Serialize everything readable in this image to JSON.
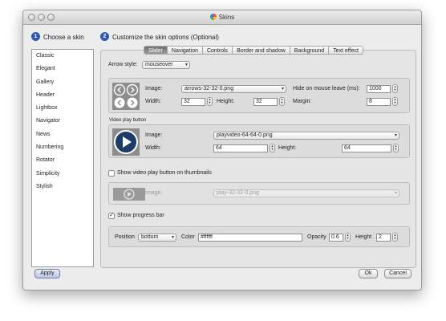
{
  "window": {
    "title": "Skins"
  },
  "step1": {
    "number": "1",
    "title": "Choose a skin"
  },
  "step2": {
    "number": "2",
    "title": "Customize the skin options (Optional)"
  },
  "skins": [
    "Classic",
    "Elegant",
    "Gallery",
    "Header",
    "Lightbox",
    "Navigator",
    "News",
    "Numbering",
    "Rotator",
    "Simplicity",
    "Stylish"
  ],
  "tabs": [
    "Slider",
    "Navigation",
    "Controls",
    "Border and shadow",
    "Background",
    "Text effect"
  ],
  "arrow_style": {
    "label": "Arrow style:",
    "value": "mouseover"
  },
  "arrows": {
    "image_label": "Image:",
    "image_value": "arrows-32-32-0.png",
    "hide_label": "Hide on mouse leave (ms):",
    "hide_value": "1000",
    "width_label": "Width:",
    "width_value": "32",
    "height_label": "Height:",
    "height_value": "32",
    "margin_label": "Margin:",
    "margin_value": "8"
  },
  "video_play": {
    "legend": "Video play button",
    "image_label": "Image:",
    "image_value": "playvideo-64-64-0.png",
    "width_label": "Width:",
    "width_value": "64",
    "height_label": "Height:",
    "height_value": "64"
  },
  "thumb_video": {
    "checkbox_label": "Show video play button on thumbnails",
    "checked": false,
    "image_label": "Image:",
    "image_value": "play-32-32-0.png"
  },
  "progress": {
    "checkbox_label": "Show progress bar",
    "checked": true,
    "checkmark": "✓",
    "position_label": "Position",
    "position_value": "bottom",
    "color_label": "Color",
    "color_value": "#ffffff",
    "opacity_label": "Opacity",
    "opacity_value": "0.6",
    "height_label": "Height",
    "height_value": "2"
  },
  "buttons": {
    "apply": "Apply",
    "ok": "Ok",
    "cancel": "Cancel"
  },
  "icons": {
    "select_arrow": "▾",
    "stepper_up": "▲",
    "stepper_down": "▼"
  }
}
